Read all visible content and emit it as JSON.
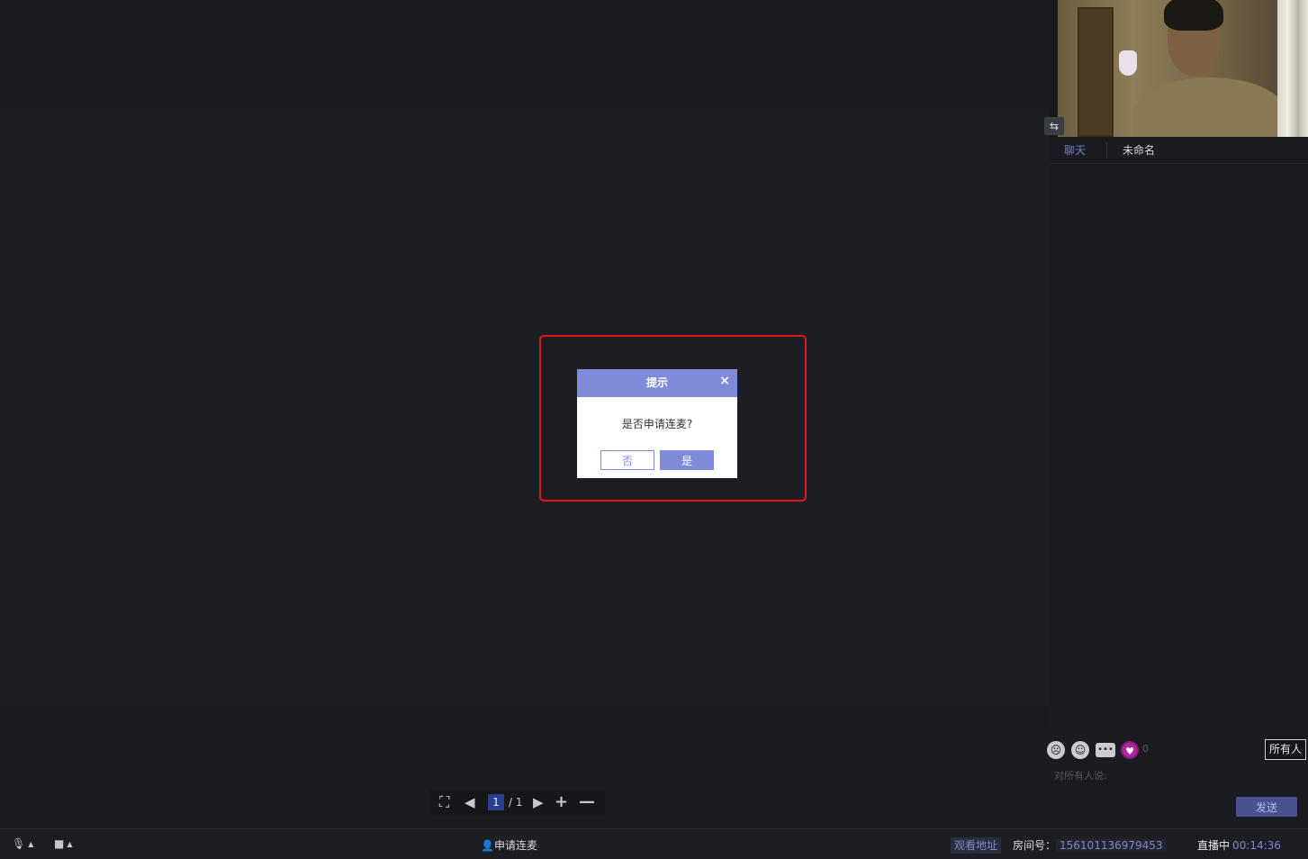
{
  "icons": {
    "swap": "swap-icon",
    "sad_face": "sad-face-icon",
    "smile": "smile-icon",
    "bubble": "chat-bubble-icon",
    "heart": "heart-icon",
    "fullscreen": "fullscreen-icon",
    "prev": "prev-page-icon",
    "next": "next-page-icon",
    "zoom_in": "plus-icon",
    "zoom_out": "minus-icon",
    "mic": "microphone-icon",
    "camera": "camera-icon",
    "close": "close-icon"
  },
  "glyphs": {
    "swap": "⇆",
    "sad_face": "☹",
    "smile": "☺",
    "bubble": "•••",
    "heart": "♥",
    "fullscreen": "⛶",
    "prev": "◀",
    "next": "▶",
    "zoom_in": "+",
    "zoom_out": "—",
    "mic": "🎙",
    "camera": "■",
    "caret": "▲",
    "close": "×",
    "person": "👤"
  },
  "tabs": {
    "chat": "聊天",
    "unnamed": "未命名"
  },
  "chat": {
    "heart_count": "0",
    "recipient": "所有人",
    "input_placeholder": "对所有人说:",
    "send_label": "发送"
  },
  "pager": {
    "current_page": "1",
    "total_pages": "/ 1"
  },
  "bottom_bar": {
    "apply_mic": "申请连麦",
    "watch_address": "观看地址",
    "room_label": "房间号：",
    "room_number": "156101136979453",
    "live_label": "直播中",
    "live_time": "00:14:36"
  },
  "dialog": {
    "title": "提示",
    "message": "是否申请连麦?",
    "no_label": "否",
    "yes_label": "是"
  },
  "colors": {
    "accent": "#7f8ad8",
    "highlight_border": "#e0161b",
    "heart": "#b1249c",
    "background": "#1a1b20"
  }
}
